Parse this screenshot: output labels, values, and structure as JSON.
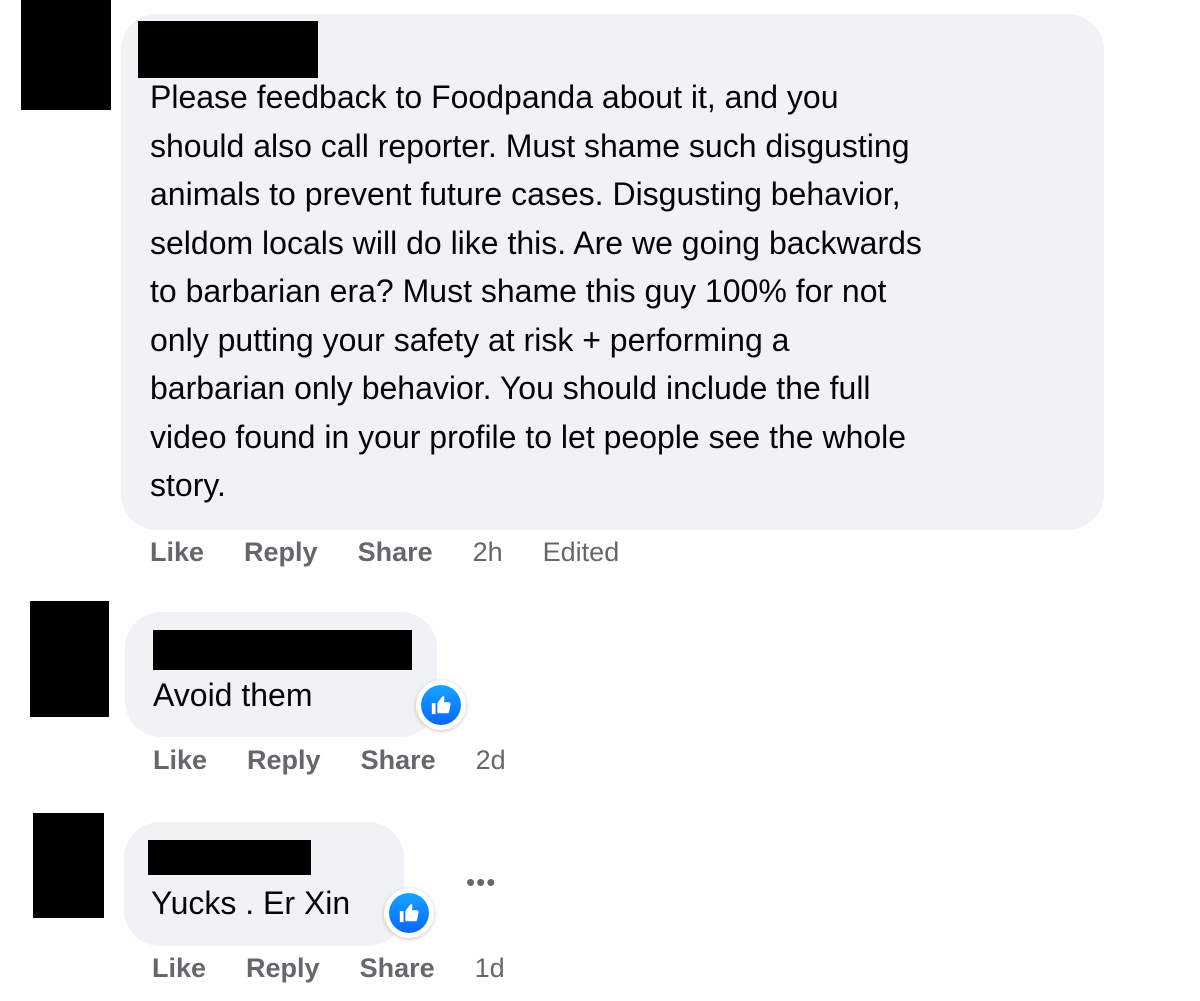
{
  "comments": [
    {
      "text": "Please feedback to Foodpanda about it, and you\nshould also call reporter. Must shame such disgusting\nanimals to prevent future cases. Disgusting behavior,\nseldom locals will do like this. Are we going backwards\nto barbarian era? Must shame this guy 100% for not\nonly putting your safety at risk + performing a\nbarbarian only behavior. You should include the full\nvideo found in your profile to let people see the whole\nstory.",
      "like": "Like",
      "reply": "Reply",
      "share": "Share",
      "time": "2h",
      "edited": "Edited"
    },
    {
      "text": "Avoid them",
      "like": "Like",
      "reply": "Reply",
      "share": "Share",
      "time": "2d",
      "reaction_icon": "like-reaction-icon"
    },
    {
      "text": "Yucks . Er Xin",
      "like": "Like",
      "reply": "Reply",
      "share": "Share",
      "time": "1d",
      "reaction_icon": "like-reaction-icon",
      "more_label": "•••"
    }
  ],
  "colors": {
    "bubble": "#f0f2f5",
    "meta_text": "#65676b",
    "like_blue": "#0866ff",
    "redaction": "#000000"
  }
}
